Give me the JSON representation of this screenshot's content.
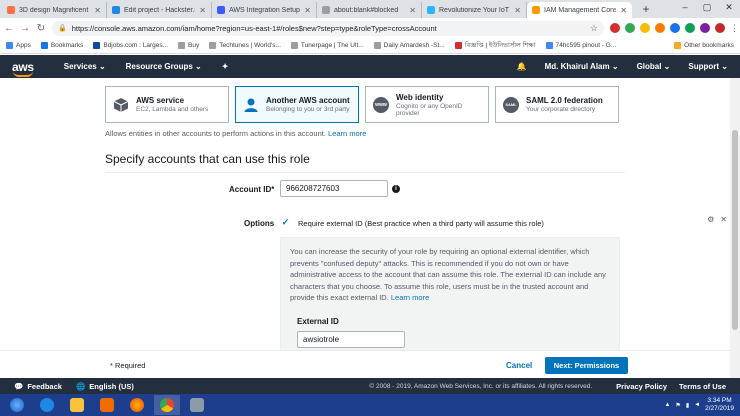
{
  "browser": {
    "tabs": [
      {
        "title": "3D design Magnificent K",
        "color": "#ff7043"
      },
      {
        "title": "Edit project - Hackster.io",
        "color": "#1e88e5"
      },
      {
        "title": "AWS Integration Setup",
        "color": "#3d5afe"
      },
      {
        "title": "about:blank#blocked",
        "color": "#9e9e9e"
      },
      {
        "title": "Revolutionize Your IoT",
        "color": "#29b6f6"
      },
      {
        "title": "IAM Management Conso",
        "color": "#ff9900"
      }
    ],
    "url": "https://console.aws.amazon.com/iam/home?region=us-east-1#/roles$new?step=type&roleType=crossAccount"
  },
  "bookmarks": {
    "items": [
      {
        "label": "Apps",
        "color": "#4285f4"
      },
      {
        "label": "Bookmarks",
        "color": "#1a73e8"
      },
      {
        "label": "Bdjobs.com : Larges...",
        "color": "#0d47a1"
      },
      {
        "label": "Buy",
        "color": "#9e9e9e"
      },
      {
        "label": "Techtunes | World's...",
        "color": "#9e9e9e"
      },
      {
        "label": "Tunerpage | The Ult...",
        "color": "#9e9e9e"
      },
      {
        "label": "Daily Amardesh -St...",
        "color": "#9e9e9e"
      },
      {
        "label": "বিজ্ঞপ্তি | ইউনিভার্সাল শিক্ষা",
        "color": "#d32f2f"
      },
      {
        "label": "74hc595 pinout - G...",
        "color": "#4285f4"
      }
    ],
    "other": "Other bookmarks"
  },
  "aws_nav": {
    "logo": "aws",
    "services": "Services",
    "resource_groups": "Resource Groups",
    "user": "Md. Khairul Alam",
    "region": "Global",
    "support": "Support"
  },
  "trusted_entities": [
    {
      "title": "AWS service",
      "subtitle": "EC2, Lambda and others",
      "icon": "cube-icon",
      "selected": false
    },
    {
      "title": "Another AWS account",
      "subtitle": "Belonging to you or 3rd party",
      "icon": "person-icon",
      "selected": true
    },
    {
      "title": "Web identity",
      "subtitle": "Cognito or any OpenID provider",
      "icon": "www-icon",
      "selected": false
    },
    {
      "title": "SAML 2.0 federation",
      "subtitle": "Your corporate directory",
      "icon": "saml-icon",
      "selected": false
    }
  ],
  "entity_icon_labels": {
    "www": "www",
    "saml": "SAML"
  },
  "allow_text": "Allows entities in other accounts to perform actions in this account.",
  "learn_more": "Learn more",
  "section_title": "Specify accounts that can use this role",
  "account_id": {
    "label": "Account ID*",
    "value": "966208727603"
  },
  "options": {
    "label": "Options",
    "require_external_id": "Require external ID (Best practice when a third party will assume this role)",
    "checked": true
  },
  "info_box": {
    "text": "You can increase the security of your role by requiring an optional external identifier, which prevents \"confused deputy\" attacks. This is recommended if you do not own or have administrative access to the account that can assume this role. The external ID can include any characters that you choose. To assume this role, users must be in the trusted account and provide this exact external ID.",
    "learn_more": "Learn more",
    "external_id_label": "External ID",
    "external_id_value": "awsiotrole"
  },
  "actions": {
    "required": "* Required",
    "cancel": "Cancel",
    "next": "Next: Permissions"
  },
  "footer": {
    "feedback": "Feedback",
    "language": "English (US)",
    "copyright": "© 2008 - 2019, Amazon Web Services, Inc. or its affiliates. All rights reserved.",
    "privacy": "Privacy Policy",
    "terms": "Terms of Use"
  },
  "taskbar": {
    "time": "3:34 PM",
    "date": "2/27/2019"
  },
  "colors": {
    "aws_dark": "#232f3e",
    "aws_orange": "#ff9900",
    "primary_blue": "#0073bb",
    "taskbar": "#1c3e8c"
  }
}
